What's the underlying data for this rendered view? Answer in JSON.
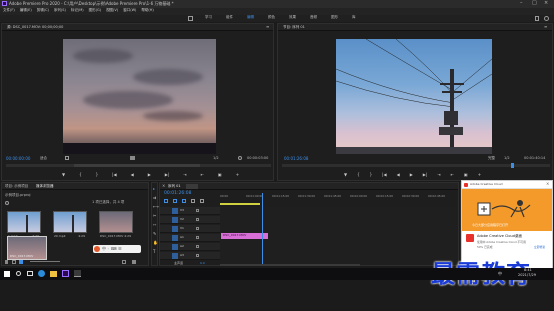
{
  "window": {
    "title": "Adobe Premiere Pro 2020 - C:\\用户\\Desktop\\示例\\Adobe Premiere Pro\\1-6 万物基础 *"
  },
  "menu": [
    "文件(F)",
    "编辑(E)",
    "剪辑(C)",
    "序列(S)",
    "标记(M)",
    "图形(G)",
    "视图(V)",
    "窗口(W)",
    "帮助(H)"
  ],
  "workspaces": [
    "学习",
    "组件",
    "编辑",
    "颜色",
    "效果",
    "音频",
    "图形",
    "库"
  ],
  "source": {
    "tab": "源: DSC_0017.MOV: 00;00;00;00",
    "timecode": "00:00:00:00",
    "fit": "适合",
    "ratio": "1/2",
    "duration": "00:00:03:00"
  },
  "program": {
    "tab": "节目: 序列 01",
    "timecode": "00:01:26:08",
    "fit": "完整",
    "ratio": "1/2",
    "duration": "00:01:40:14"
  },
  "project": {
    "tabs": [
      "项目: 示例项目",
      "媒体浏览器"
    ],
    "name": "示例项目.prproj",
    "item_count": "1 项已选择，共 4 项",
    "items": [
      {
        "label": "1.mp4",
        "dur": "4:29",
        "kind": "pole"
      },
      {
        "label": "20.mp4",
        "dur": "4:29",
        "kind": "pole"
      },
      {
        "label": "DSC_0017.MOV",
        "dur": "4:29",
        "kind": "sky"
      },
      {
        "label": "DSC_0017.MOV",
        "dur": "3:00",
        "kind": "sky"
      }
    ]
  },
  "timeline": {
    "tab": "序列 01",
    "timecode": "00:01:26:08",
    "rulers": [
      "00:00",
      "00:01:00:00",
      "00:01:15:00",
      "00:01:30:00",
      "00:01:45:00",
      "00:02:00:00",
      "00:02:15:00",
      "00:02:30:00",
      "00:02:45:00"
    ],
    "video_tracks": [
      "V3",
      "V2",
      "V1"
    ],
    "audio_tracks": [
      "A1",
      "A2",
      "A3"
    ],
    "master": "主声道",
    "master_val": "0.0",
    "clip_label": "DSC_0017.MOV"
  },
  "notification": {
    "header": "Adobe Creative Cloud",
    "line1": "今日大部分应用程序已打开",
    "app_name": "Adobe Creative Cloud桌面",
    "app_desc": "使用中 Adobe Creative Cloud 不可用",
    "percent": "50% 已完成",
    "button": "立即修复"
  },
  "watermark": "最需教育",
  "taskbar": {
    "time": "8:41",
    "date": "2021/7/29",
    "lang": "中"
  },
  "colors": {
    "accent": "#3d8ee6",
    "clip": "#d86fd6",
    "playhead": "#3d8ee6",
    "notification_orange": "#f39a2b"
  }
}
